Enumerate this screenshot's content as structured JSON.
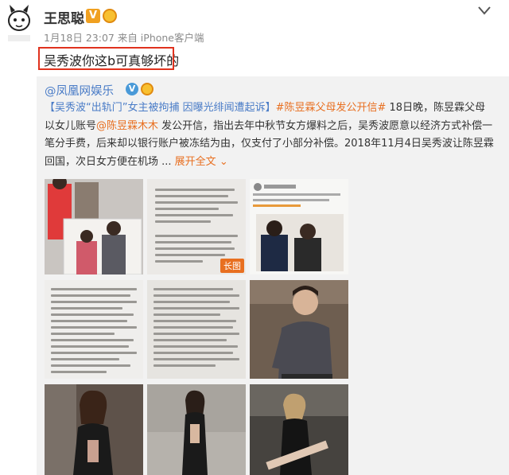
{
  "post": {
    "author": "王思聪",
    "verified_badge": "V",
    "meta": "1月18日 23:07 来自 iPhone客户端",
    "text": "吴秀波你这b可真够坏的",
    "highlight_color": "#e0321e"
  },
  "repost": {
    "author": "@凤凰网娱乐",
    "verified_badge": "V",
    "segments": {
      "topic1": "【吴秀波“出轨门”女主被拘捕 因曝光绯闻遭起诉】",
      "topic2": "#陈昱霖父母发公开信#",
      "p1": " 18日晚，陈昱霖父母以女儿账号",
      "mention": "@陈昱霖木木",
      "p2": " 发公开信，指出去年中秋节女方爆料之后，吴秀波愿意以经济方式补偿一笔分手费，后来却以银行账户被冻结为由，仅支付了小部分补偿。2018年11月4日吴秀波让陈昱霖回国，次日女方便在机场 ...",
      "expand": "展开全文",
      "expand_icon": "chevron-down-icon"
    },
    "long_image_badge": "长图",
    "accent_color": "#e86f20",
    "link_color": "#4a7cc7"
  },
  "images": [
    {
      "name": "photo-couple-1",
      "desc": "photo"
    },
    {
      "name": "screenshot-document-1",
      "desc": "document"
    },
    {
      "name": "screenshot-social-1",
      "desc": "screenshot"
    },
    {
      "name": "screenshot-document-2",
      "desc": "document"
    },
    {
      "name": "screenshot-document-3",
      "desc": "document"
    },
    {
      "name": "photo-man",
      "desc": "photo"
    },
    {
      "name": "photo-woman-1",
      "desc": "photo"
    },
    {
      "name": "photo-woman-2",
      "desc": "photo"
    },
    {
      "name": "photo-woman-3",
      "desc": "photo"
    }
  ]
}
